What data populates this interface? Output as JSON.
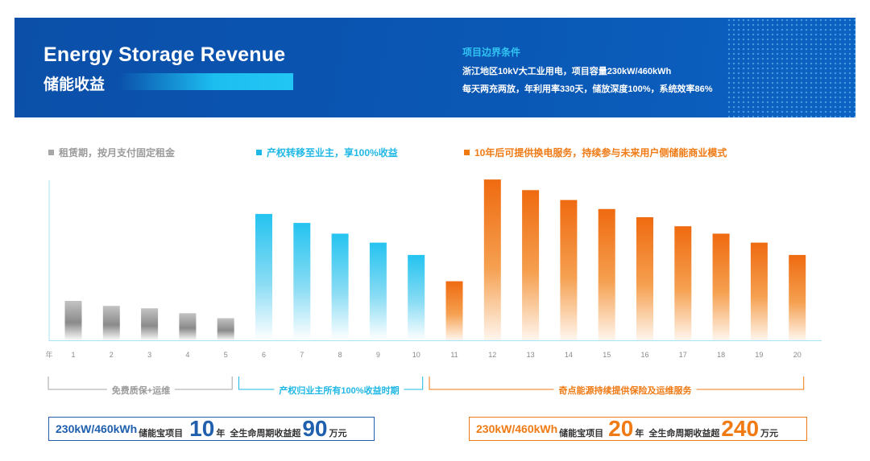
{
  "header": {
    "title_en": "Energy Storage Revenue",
    "title_cn": "储能收益",
    "conditions_title": "项目边界条件",
    "conditions": [
      "浙江地区10kV大工业用电，项目容量230kW/460kWh",
      "每天两充两放，年利用率330天，储放深度100%，系统效率86%"
    ]
  },
  "legend": [
    {
      "label": "租赁期，按月支付固定租金",
      "color": "#a6a6a6"
    },
    {
      "label": "产权转移至业主，享100%收益",
      "color": "#1fb8e6"
    },
    {
      "label": "10年后可提供换电服务，持续参与未来用户侧储能商业模式",
      "color": "#f07a14"
    }
  ],
  "chart_data": {
    "type": "bar",
    "xlabel": "年",
    "ylabel": "",
    "categories": [
      "1",
      "2",
      "3",
      "4",
      "5",
      "6",
      "7",
      "8",
      "9",
      "10",
      "11",
      "12",
      "13",
      "14",
      "15",
      "16",
      "17",
      "18",
      "19",
      "20"
    ],
    "values": [
      24,
      21,
      19.5,
      16.5,
      13.5,
      77,
      71.5,
      65,
      59.5,
      52,
      36,
      98,
      91.5,
      85.5,
      80,
      75,
      69.5,
      65,
      59.5,
      52
    ],
    "ylim": [
      0,
      100
    ],
    "grid": false,
    "phase_colors": [
      [
        "#c3c3c3",
        "#8a8a8a",
        "#fbfbfb"
      ],
      [
        "#24c3f0",
        "#8adcf4",
        "#ffffff"
      ],
      [
        "#ef6a10",
        "#f5a050",
        "#fff6ee"
      ]
    ],
    "phases": [
      {
        "label": "免费质保+运维",
        "from": 1,
        "to": 5,
        "color": "#a6a6a6"
      },
      {
        "label": "产权归业主所有100%收益时期",
        "from": 6,
        "to": 10,
        "color": "#1fb8e6"
      },
      {
        "label": "奇点能源持续提供保险及运维服务",
        "from": 11,
        "to": 20,
        "color": "#f07a14"
      }
    ]
  },
  "summary_left": {
    "capacity": "230kW/460kWh",
    "product": "储能宝项目",
    "years": "10",
    "years_unit": "年",
    "text": "全生命周期收益超",
    "amount": "90",
    "amount_unit": "万元",
    "color": "#1f5fae"
  },
  "summary_right": {
    "capacity": "230kW/460kWh",
    "product": "储能宝项目",
    "years": "20",
    "years_unit": "年",
    "text": "全生命周期收益超",
    "amount": "240",
    "amount_unit": "万元",
    "color": "#f07a14"
  }
}
